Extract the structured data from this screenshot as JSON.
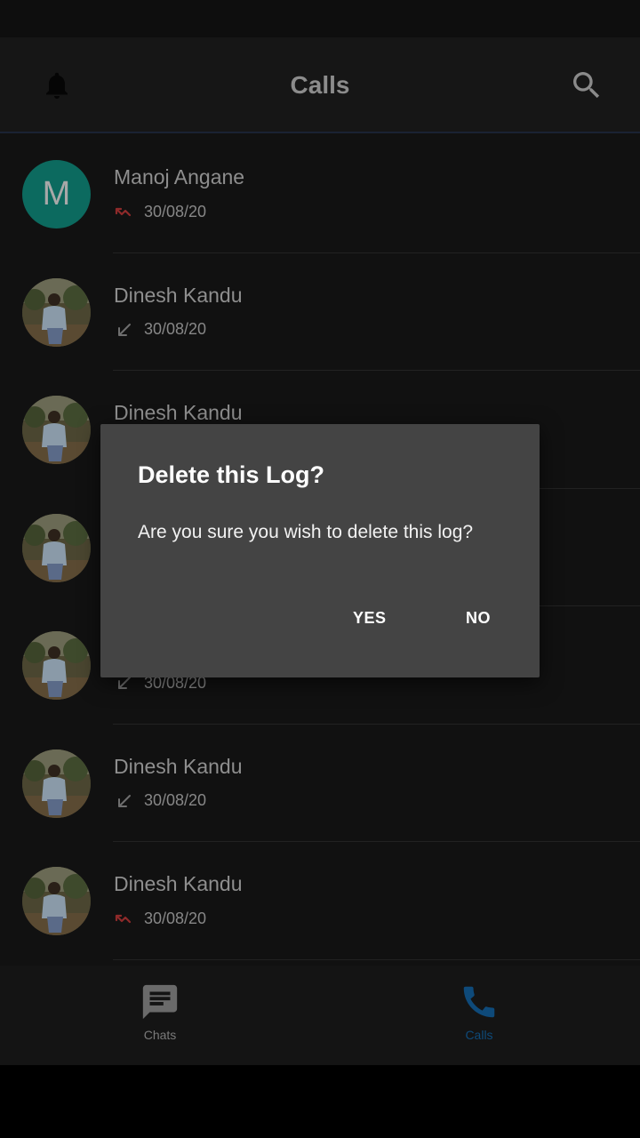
{
  "app_bar": {
    "title": "Calls",
    "left_icon": "bell-icon",
    "right_icon": "search-icon"
  },
  "calls": [
    {
      "name": "Manoj Angane",
      "date": "30/08/20",
      "type": "missed",
      "avatar_letter": "M"
    },
    {
      "name": "Dinesh Kandu",
      "date": "30/08/20",
      "type": "incoming",
      "avatar_letter": ""
    },
    {
      "name": "Dinesh Kandu",
      "date": "",
      "type": "incoming",
      "avatar_letter": ""
    },
    {
      "name": "",
      "date": "",
      "type": "incoming",
      "avatar_letter": ""
    },
    {
      "name": "",
      "date": "30/08/20",
      "type": "incoming",
      "avatar_letter": ""
    },
    {
      "name": "Dinesh Kandu",
      "date": "30/08/20",
      "type": "incoming",
      "avatar_letter": ""
    },
    {
      "name": "Dinesh Kandu",
      "date": "30/08/20",
      "type": "missed",
      "avatar_letter": ""
    }
  ],
  "bottom_nav": {
    "chats_label": "Chats",
    "calls_label": "Calls",
    "active": "Calls"
  },
  "dialog": {
    "title": "Delete this Log?",
    "message": "Are you sure you wish to delete this log?",
    "yes_label": "YES",
    "no_label": "NO"
  },
  "colors": {
    "missed": "#8e2a2a",
    "incoming": "#6e6e6e",
    "accent": "#0e4a7a",
    "avatar_letter_bg": "#0c6a5f"
  }
}
